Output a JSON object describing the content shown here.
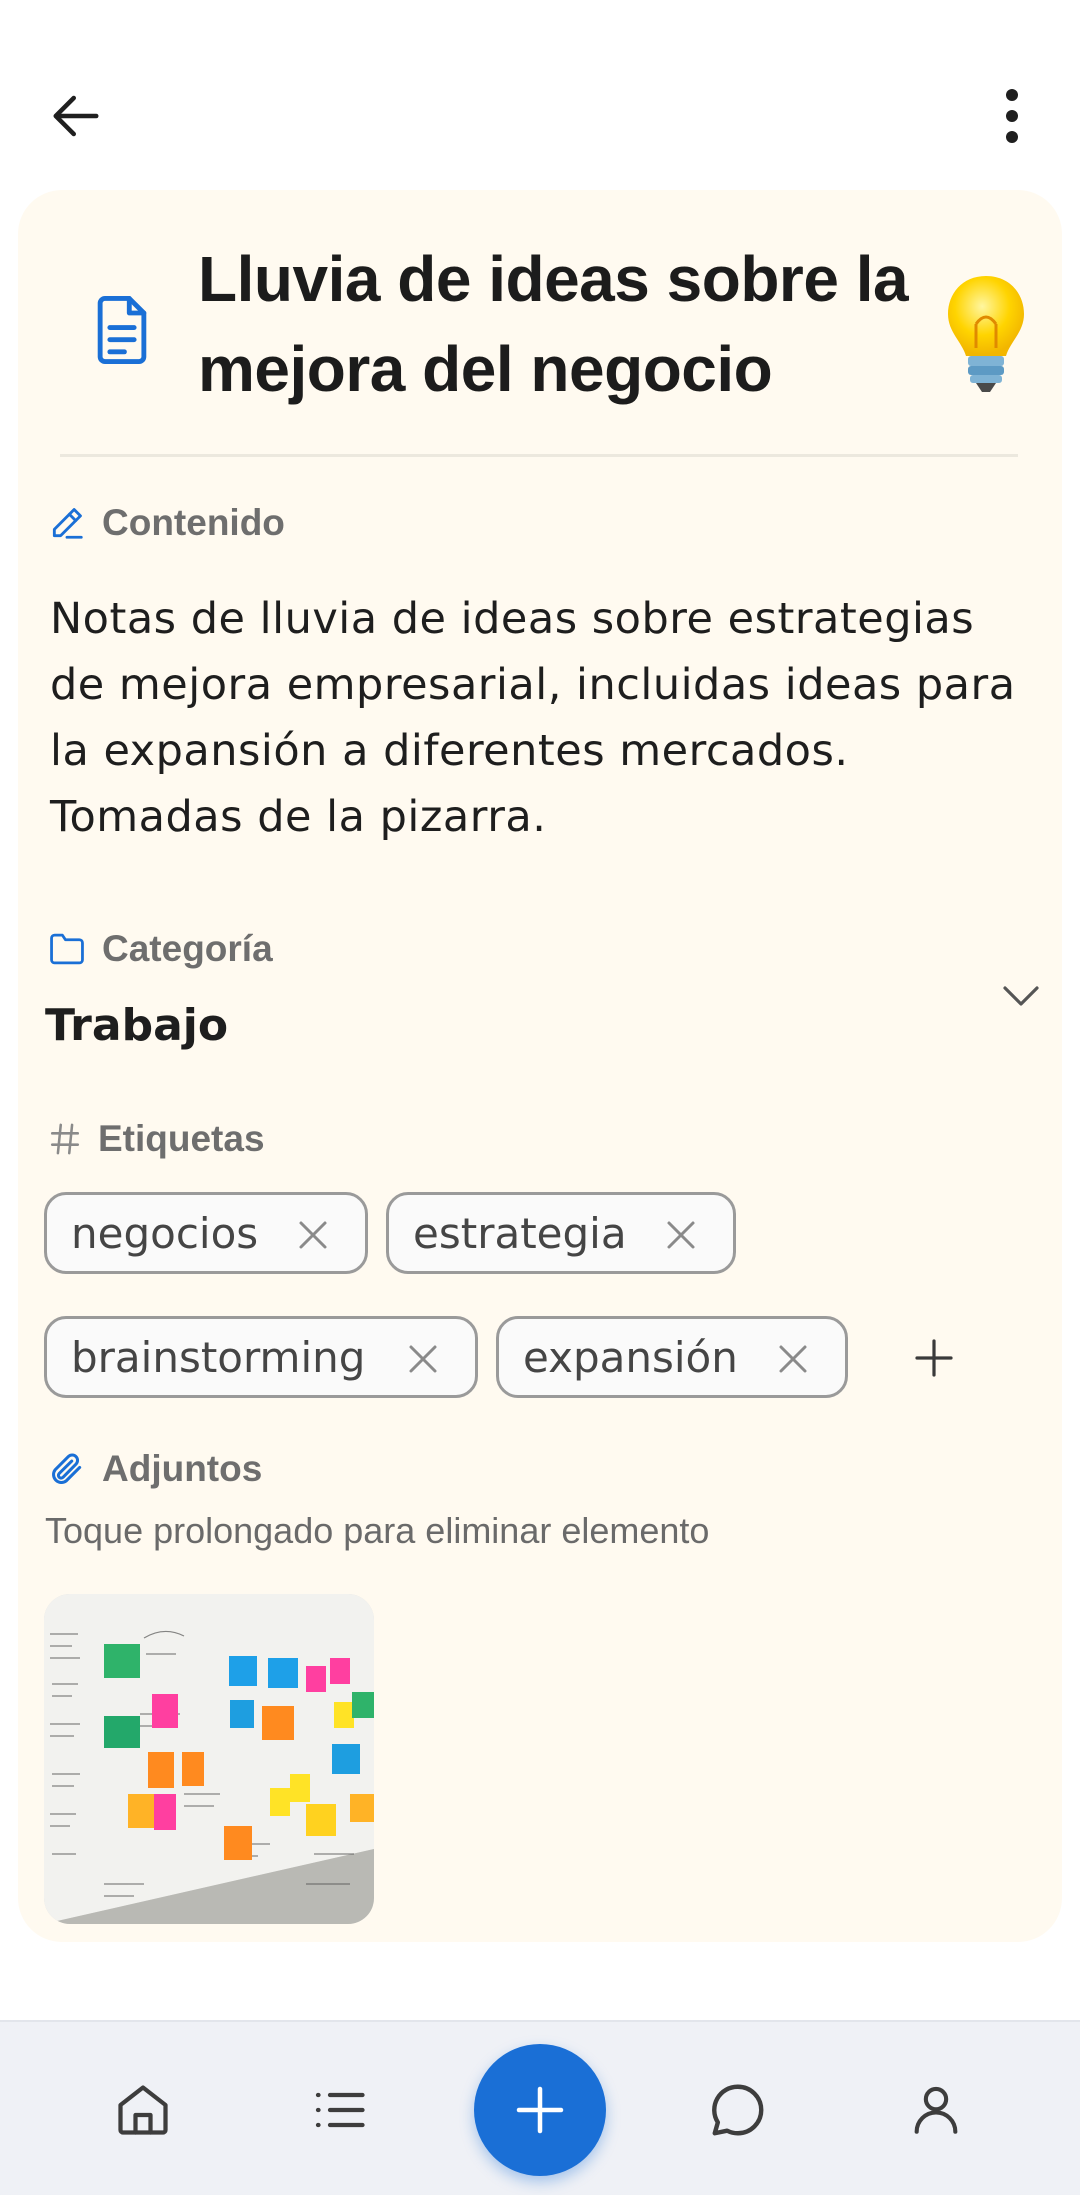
{
  "note": {
    "title": "Lluvia de ideas sobre la mejora del negocio",
    "emoji": "💡"
  },
  "content": {
    "label": "Contenido",
    "text": "Notas de lluvia de ideas sobre estrategias de mejora empresarial, incluidas ideas para la expansión a diferentes mercados. Tomadas de la pizarra."
  },
  "category": {
    "label": "Categoría",
    "value": "Trabajo"
  },
  "tags": {
    "label": "Etiquetas",
    "items": [
      "negocios",
      "estrategia",
      "brainstorming",
      "expansión"
    ]
  },
  "attachments": {
    "label": "Adjuntos",
    "hint": "Toque prolongado para eliminar elemento"
  },
  "icons": {
    "back": "arrow-left-icon",
    "more": "more-vertical-icon",
    "document": "document-icon",
    "pencil": "pencil-icon",
    "folder": "folder-icon",
    "hash": "hash-icon",
    "paperclip": "paperclip-icon",
    "home": "home-icon",
    "list": "list-icon",
    "add": "plus-icon",
    "chat": "chat-icon",
    "profile": "user-icon"
  },
  "colors": {
    "accent": "#1a6fd6",
    "card_background": "#fffaf0",
    "nav_background": "#eff1f6"
  }
}
